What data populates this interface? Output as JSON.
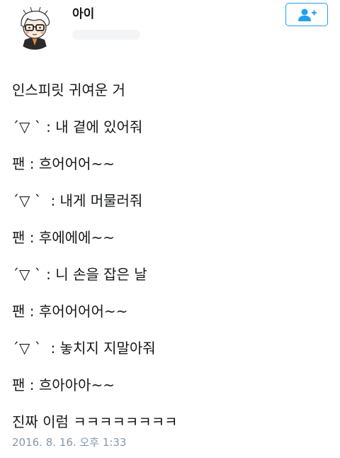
{
  "user": {
    "name": "아이"
  },
  "tweet": {
    "lines": [
      "인스피릿 귀여운 거",
      "´▽ ` : 내 곁에 있어줘",
      "팬 : 흐어어어~~",
      "´▽ `  : 내게 머물러줘",
      "팬 : 후에에에~~",
      "´▽ ` : 니 손을 잡은 날",
      "팬 : 후어어어어~~",
      "´▽ `  : 놓치지 지말아줘",
      "팬 : 흐아아아~~",
      "진짜 이럼 ㅋㅋㅋㅋㅋㅋㅋㅋ"
    ],
    "timestamp": "2016. 8. 16. 오후 1:33"
  },
  "icons": {
    "follow": "add-user-icon"
  },
  "colors": {
    "accent": "#1da1f2",
    "text": "#14171a",
    "muted": "#8899a6"
  }
}
